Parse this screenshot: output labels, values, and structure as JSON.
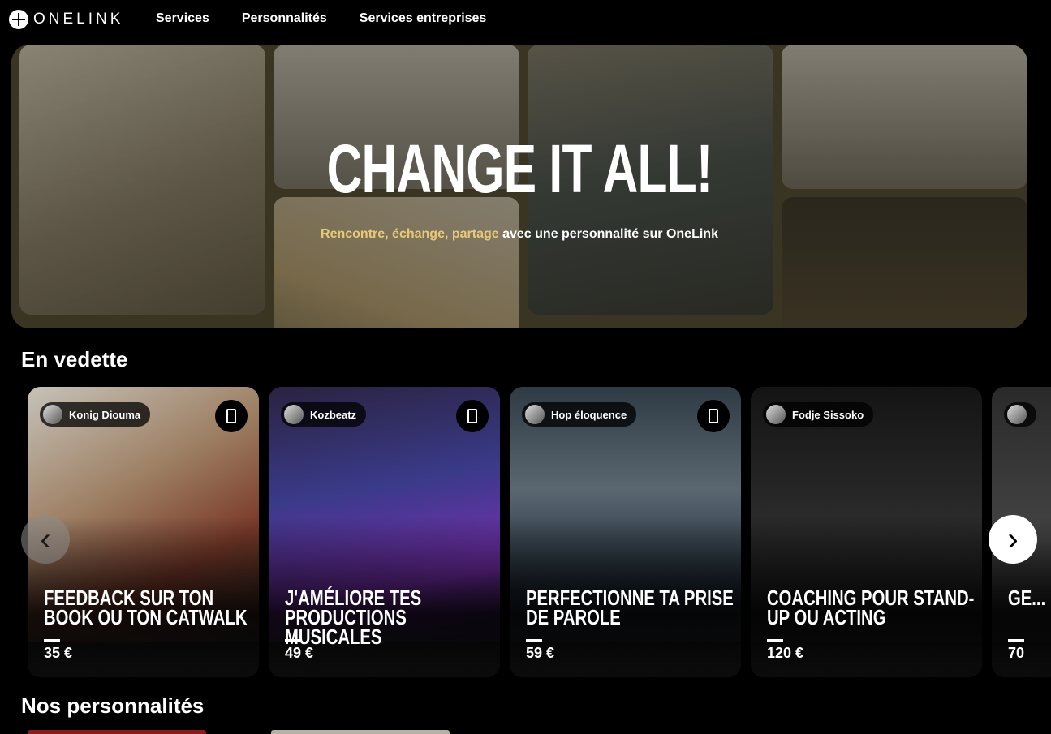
{
  "brand": {
    "logo_text": "ONELINK"
  },
  "nav": {
    "items": [
      "Services",
      "Personnalités",
      "Services entreprises"
    ]
  },
  "hero": {
    "title": "CHANGE IT ALL!",
    "subtitle_highlight": "Rencontre, échange, partage",
    "subtitle_rest": " avec une personnalité sur OneLink"
  },
  "featured": {
    "title": "En vedette",
    "cards": [
      {
        "name": "Konig Diouma",
        "title": "Feedback sur ton book ou ton catwalk",
        "price": "35 €"
      },
      {
        "name": "Kozbeatz",
        "title": "J'améliore tes productions musicales",
        "price": "49 €"
      },
      {
        "name": "Hop éloquence",
        "title": "Perfectionne ta prise de parole",
        "price": "59 €"
      },
      {
        "name": "Fodje Sissoko",
        "title": "Coaching pour stand-up ou acting",
        "price": "120 €"
      },
      {
        "name": "",
        "title": "Ge... Re...",
        "price": "70"
      }
    ]
  },
  "personalities": {
    "title": "Nos personnalités"
  },
  "icons": {
    "prev": "chevron-left-icon",
    "next": "chevron-right-icon",
    "phone": "phone-icon"
  }
}
